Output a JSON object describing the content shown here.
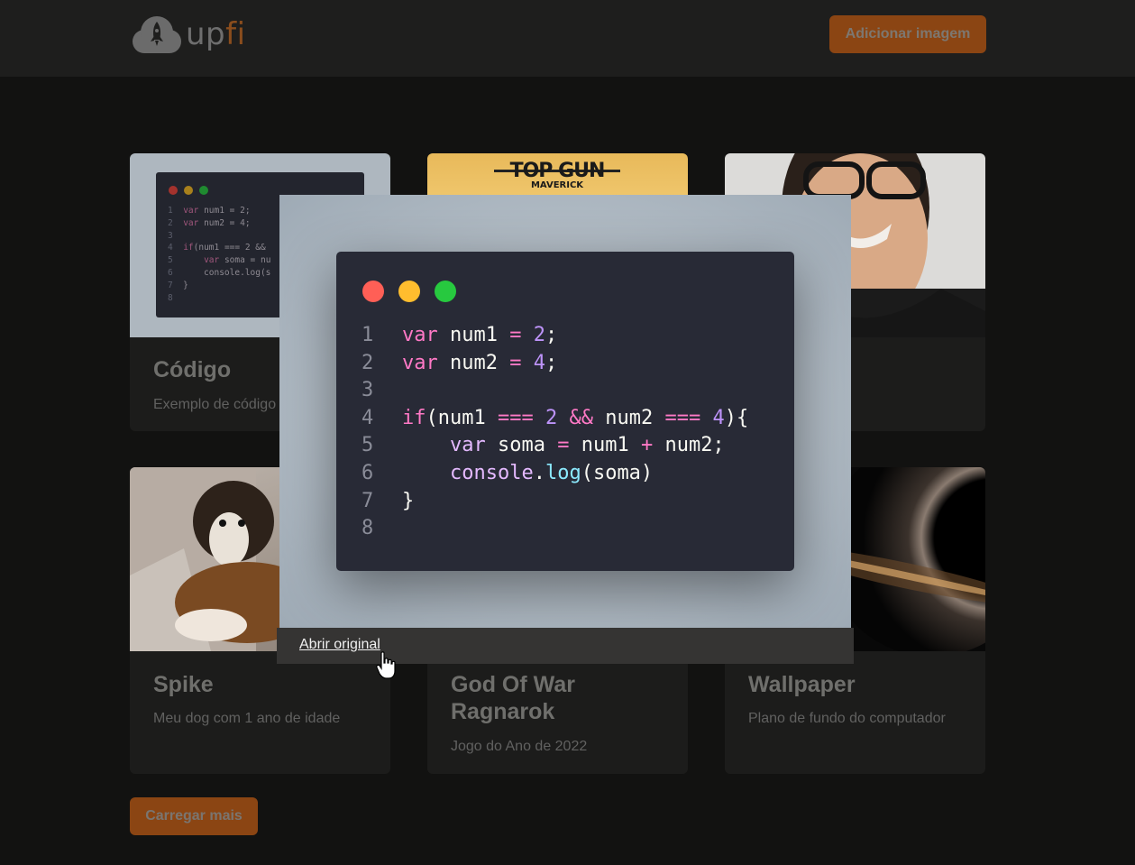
{
  "header": {
    "logo_prefix": "up",
    "logo_suffix": "fi",
    "add_button": "Adicionar imagem"
  },
  "cards": [
    {
      "title": "Código",
      "description": "Exemplo de código"
    },
    {
      "title": "",
      "description": ""
    },
    {
      "title": "",
      "description": ""
    },
    {
      "title": "Spike",
      "description": "Meu dog com 1 ano de idade"
    },
    {
      "title": "God Of War Ragnarok",
      "description": "Jogo do Ano de 2022"
    },
    {
      "title": "Wallpaper",
      "description": "Plano de fundo do computador"
    }
  ],
  "top_gun_text": {
    "line1": "TOP GUN",
    "line2": "MAVERICK"
  },
  "load_more": "Carregar mais",
  "modal": {
    "open_link": "Abrir original",
    "code_lines": [
      "var num1 = 2;",
      "var num2 = 4;",
      "",
      "if(num1 === 2 && num2 === 4){",
      "    var soma = num1 + num2;",
      "    console.log(soma)",
      "}",
      ""
    ],
    "line_numbers": [
      "1",
      "2",
      "3",
      "4",
      "5",
      "6",
      "7",
      "8"
    ]
  },
  "colors": {
    "accent": "#8b4513",
    "code_bg": "#282a36",
    "dot_red": "#ff5f56",
    "dot_yellow": "#ffbd2e",
    "dot_green": "#27c93f"
  }
}
